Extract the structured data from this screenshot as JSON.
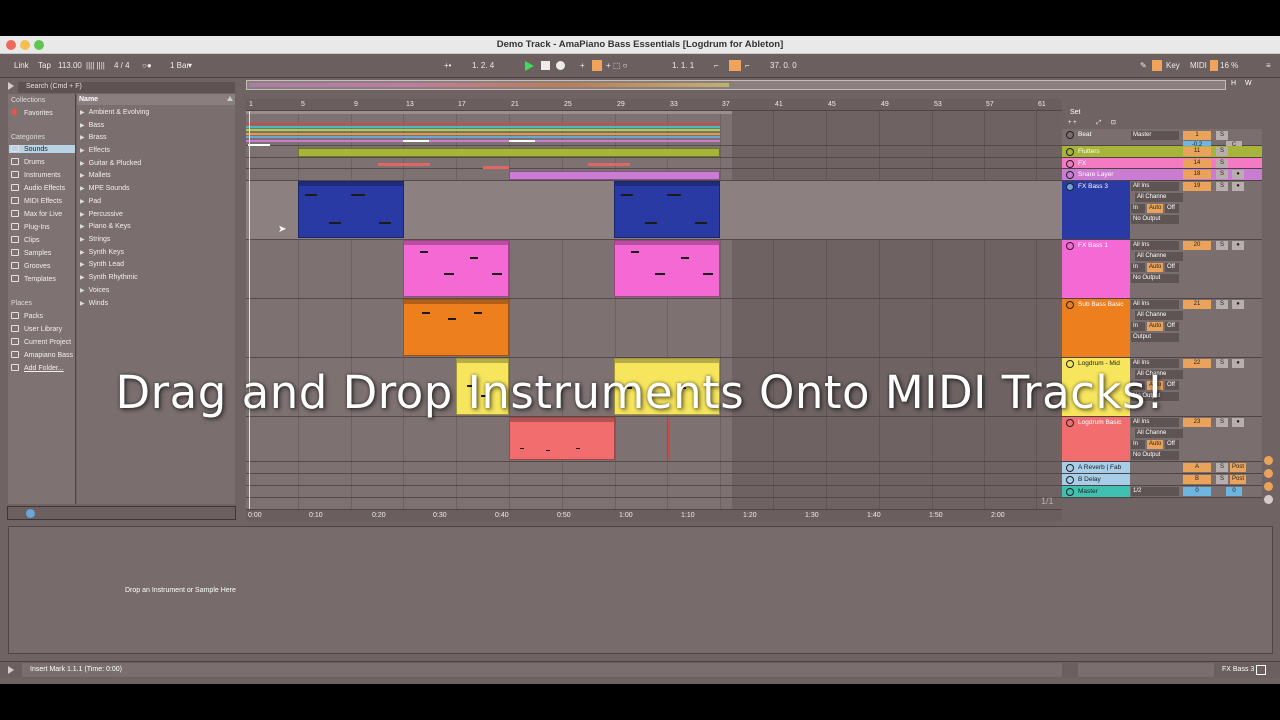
{
  "window": {
    "title": "Demo Track - AmaPiano Bass Essentials  [Logdrum for Ableton]"
  },
  "controlbar": {
    "link": "Link",
    "tap": "Tap",
    "tempo": "113.00",
    "meter_icon": "|||| ||||",
    "time_signature": "4 / 4",
    "metronome": "○●",
    "quantize": "1 Bar",
    "arrangement_position": "1.   2.   4",
    "loop_start": "1.   1.   1",
    "loop_length": "37.   0.   0",
    "key_label": "Key",
    "midi_label": "MIDI",
    "cpu": "16 %"
  },
  "browser": {
    "search_placeholder": "Search (Cmd + F)",
    "collections_title": "Collections",
    "favorites": "Favorites",
    "categories_title": "Categories",
    "categories": [
      "Sounds",
      "Drums",
      "Instruments",
      "Audio Effects",
      "MIDI Effects",
      "Max for Live",
      "Plug-Ins",
      "Clips",
      "Samples",
      "Grooves",
      "Templates"
    ],
    "places_title": "Places",
    "places": [
      "Packs",
      "User Library",
      "Current Project",
      "Amapiano Bass",
      "Add Folder..."
    ],
    "name_header": "Name",
    "items": [
      "Ambient & Evolving",
      "Bass",
      "Brass",
      "Effects",
      "Guitar & Plucked",
      "Mallets",
      "MPE Sounds",
      "Pad",
      "Percussive",
      "Piano & Keys",
      "Strings",
      "Synth Keys",
      "Synth Lead",
      "Synth Rhythmic",
      "Voices",
      "Winds"
    ]
  },
  "ruler": {
    "bars": [
      "1",
      "5",
      "9",
      "13",
      "17",
      "21",
      "25",
      "29",
      "33",
      "37",
      "41",
      "45",
      "49",
      "53",
      "57",
      "61"
    ]
  },
  "timeline": {
    "labels": [
      "0:00",
      "0:10",
      "0:20",
      "0:30",
      "0:40",
      "0:50",
      "1:00",
      "1:10",
      "1:20",
      "1:30",
      "1:40",
      "1:50",
      "2:00"
    ],
    "page": "1/1"
  },
  "mixer": {
    "set_label": "Set",
    "tracks": [
      {
        "name": "Beat",
        "input": "Master",
        "num": "1",
        "vol": "-0.2",
        "pan": "C",
        "color": "#7a6e6e"
      },
      {
        "name": "Flutters",
        "num": "11",
        "color": "#a6b43a"
      },
      {
        "name": "FX",
        "num": "14",
        "color": "#f47ac2"
      },
      {
        "name": "Snare Layer",
        "num": "18",
        "color": "#c97cd1"
      },
      {
        "name": "FX Bass 3",
        "num": "19",
        "color": "#2a3aa4",
        "input": "All Ins",
        "channel": "All Channe",
        "monitor": [
          "In",
          "Auto",
          "Off"
        ],
        "output": "No Output"
      },
      {
        "name": "FX Bass 1",
        "num": "20",
        "color": "#f569d4",
        "input": "All Ins",
        "channel": "All Channe",
        "monitor": [
          "In",
          "Auto",
          "Off"
        ],
        "output": "No Output"
      },
      {
        "name": "Sub Bass Basic",
        "num": "21",
        "color": "#ee7f1f",
        "input": "All Ins",
        "channel": "All Channe",
        "monitor": [
          "In",
          "Auto",
          "Off"
        ],
        "output": "Output"
      },
      {
        "name": "Logdrum - Mid",
        "num": "22",
        "color": "#f6e55d",
        "input": "All Ins",
        "channel": "All Channe",
        "monitor": [
          "In",
          "Auto",
          "Off"
        ],
        "output": "No Output"
      },
      {
        "name": "Logdrum Basic",
        "num": "23",
        "color": "#f26e6e",
        "input": "All Ins",
        "channel": "All Channe",
        "monitor": [
          "In",
          "Auto",
          "Off"
        ],
        "output": "No Output"
      },
      {
        "name": "A Reverb | Fab",
        "num": "A",
        "send": "Post",
        "color": "#a7cde9"
      },
      {
        "name": "B Delay",
        "num": "B",
        "send": "Post",
        "color": "#a7cde9"
      },
      {
        "name": "Master",
        "input": "1/2",
        "num": "0",
        "vol": "0",
        "color": "#3fc0b0"
      }
    ]
  },
  "detail": {
    "drop_hint": "Drop an Instrument or Sample Here"
  },
  "status": {
    "message": "Insert Mark 1.1.1 (Time: 0:00)",
    "selected_track": "FX Bass 3"
  },
  "overlay": {
    "caption": "Drag and Drop Instruments Onto MIDI Tracks!"
  },
  "colors": {
    "accent_orange": "#f0a35a",
    "play_green": "#3ddc5a",
    "selection_blue": "#b8d3e4"
  }
}
